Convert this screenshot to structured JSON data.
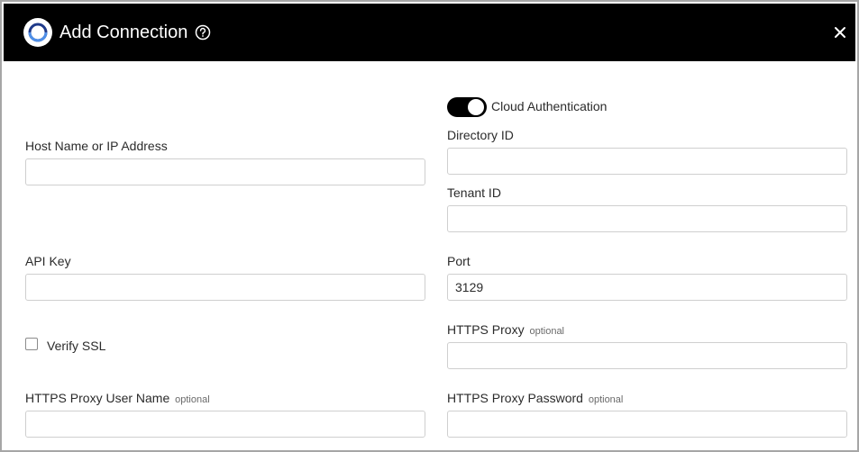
{
  "dialog": {
    "title": "Add Connection",
    "icons": {
      "logo": "app-logo-icon",
      "help": "help-circle-icon",
      "close": "close-icon"
    }
  },
  "form": {
    "cloud_auth": {
      "label": "Cloud Authentication",
      "enabled": true
    },
    "host": {
      "label": "Host Name or IP Address",
      "value": ""
    },
    "directory_id": {
      "label": "Directory ID",
      "value": ""
    },
    "tenant_id": {
      "label": "Tenant ID",
      "value": ""
    },
    "api_key": {
      "label": "API Key",
      "value": ""
    },
    "port": {
      "label": "Port",
      "value": "3129"
    },
    "verify_ssl": {
      "label": "Verify SSL",
      "checked": false
    },
    "https_proxy": {
      "label": "HTTPS Proxy",
      "optional": "optional",
      "value": ""
    },
    "proxy_user": {
      "label": "HTTPS Proxy User Name",
      "optional": "optional",
      "value": ""
    },
    "proxy_password": {
      "label": "HTTPS Proxy Password",
      "optional": "optional",
      "value": ""
    }
  },
  "colors": {
    "header_bg": "#000000",
    "toggle_on": "#000000",
    "border": "#cfcfcf"
  }
}
